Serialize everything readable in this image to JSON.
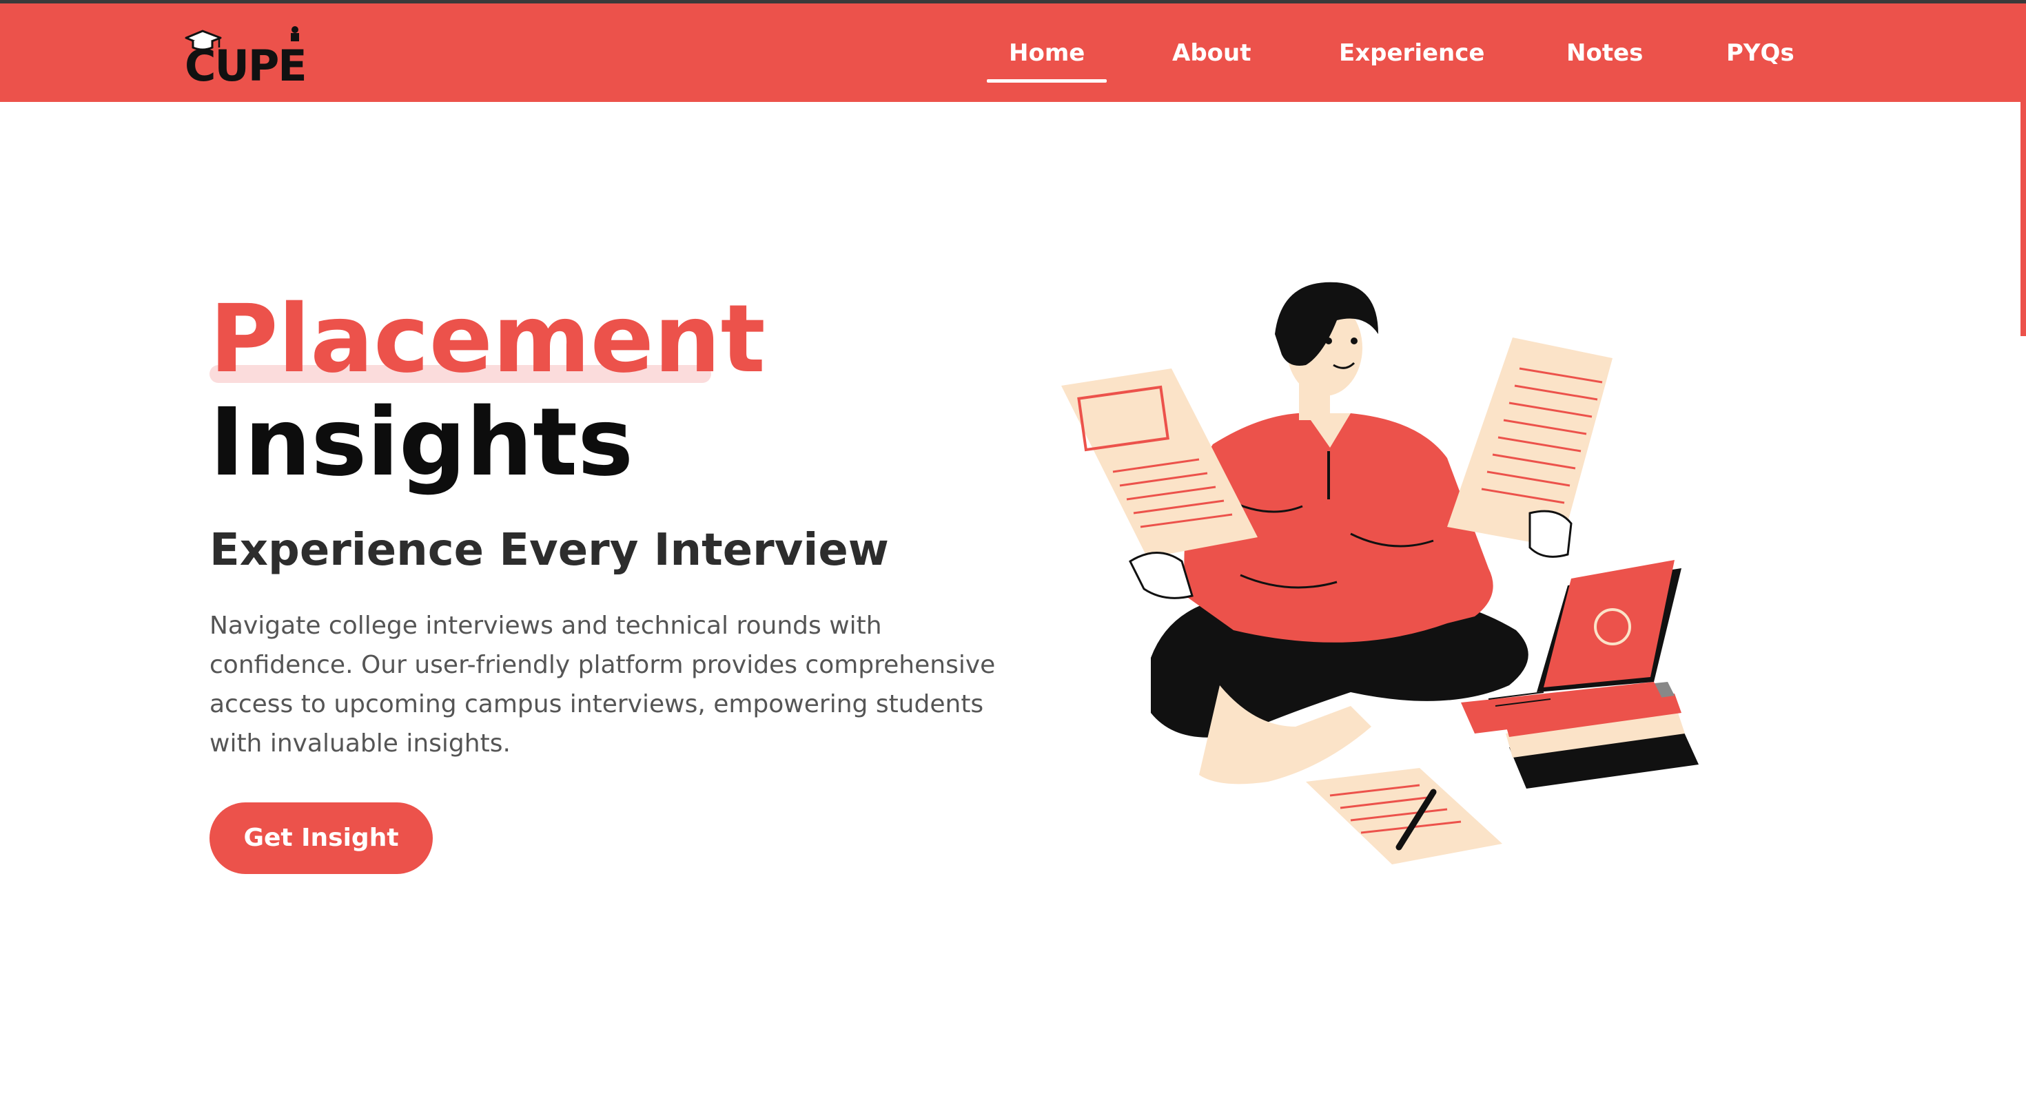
{
  "brand": {
    "logo_text": "CUPE",
    "accent_color": "#ec524b"
  },
  "nav": {
    "items": [
      {
        "label": "Home",
        "active": true
      },
      {
        "label": "About",
        "active": false
      },
      {
        "label": "Experience",
        "active": false
      },
      {
        "label": "Notes",
        "active": false
      },
      {
        "label": "PYQs",
        "active": false
      }
    ]
  },
  "hero": {
    "title_line1": "Placement",
    "title_line2": "Insights",
    "subtitle": "Experience Every Interview",
    "description": "Navigate college interviews and technical rounds with confidence. Our user-friendly platform provides comprehensive access to upcoming campus interviews, empowering students with invaluable insights.",
    "cta_label": "Get Insight"
  },
  "icons": {
    "logo": "graduation-cap-logo-icon",
    "illustration": "student-reading-laptop-illustration"
  }
}
